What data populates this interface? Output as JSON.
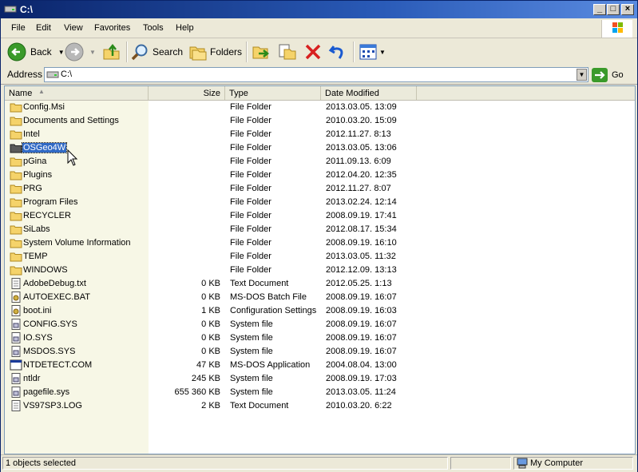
{
  "window": {
    "title": "C:\\"
  },
  "menu": [
    "File",
    "Edit",
    "View",
    "Favorites",
    "Tools",
    "Help"
  ],
  "toolbar": {
    "back_label": "Back",
    "search_label": "Search",
    "folders_label": "Folders"
  },
  "address": {
    "label": "Address",
    "value": "C:\\",
    "go_label": "Go"
  },
  "columns": {
    "name": "Name",
    "size": "Size",
    "type": "Type",
    "date": "Date Modified"
  },
  "files": [
    {
      "name": "Config.Msi",
      "size": "",
      "type": "File Folder",
      "date": "2013.03.05. 13:09",
      "icon": "folder"
    },
    {
      "name": "Documents and Settings",
      "size": "",
      "type": "File Folder",
      "date": "2010.03.20. 15:09",
      "icon": "folder"
    },
    {
      "name": "Intel",
      "size": "",
      "type": "File Folder",
      "date": "2012.11.27. 8:13",
      "icon": "folder"
    },
    {
      "name": "OSGeo4W",
      "size": "",
      "type": "File Folder",
      "date": "2013.03.05. 13:06",
      "icon": "folder",
      "selected": true
    },
    {
      "name": "pGina",
      "size": "",
      "type": "File Folder",
      "date": "2011.09.13. 6:09",
      "icon": "folder"
    },
    {
      "name": "Plugins",
      "size": "",
      "type": "File Folder",
      "date": "2012.04.20. 12:35",
      "icon": "folder"
    },
    {
      "name": "PRG",
      "size": "",
      "type": "File Folder",
      "date": "2012.11.27. 8:07",
      "icon": "folder"
    },
    {
      "name": "Program Files",
      "size": "",
      "type": "File Folder",
      "date": "2013.02.24. 12:14",
      "icon": "folder"
    },
    {
      "name": "RECYCLER",
      "size": "",
      "type": "File Folder",
      "date": "2008.09.19. 17:41",
      "icon": "folder"
    },
    {
      "name": "SiLabs",
      "size": "",
      "type": "File Folder",
      "date": "2012.08.17. 15:34",
      "icon": "folder"
    },
    {
      "name": "System Volume Information",
      "size": "",
      "type": "File Folder",
      "date": "2008.09.19. 16:10",
      "icon": "folder"
    },
    {
      "name": "TEMP",
      "size": "",
      "type": "File Folder",
      "date": "2013.03.05. 11:32",
      "icon": "folder"
    },
    {
      "name": "WINDOWS",
      "size": "",
      "type": "File Folder",
      "date": "2012.12.09. 13:13",
      "icon": "folder"
    },
    {
      "name": "AdobeDebug.txt",
      "size": "0 KB",
      "type": "Text Document",
      "date": "2012.05.25. 1:13",
      "icon": "text"
    },
    {
      "name": "AUTOEXEC.BAT",
      "size": "0 KB",
      "type": "MS-DOS Batch File",
      "date": "2008.09.19. 16:07",
      "icon": "gear"
    },
    {
      "name": "boot.ini",
      "size": "1 KB",
      "type": "Configuration Settings",
      "date": "2008.09.19. 16:03",
      "icon": "gear"
    },
    {
      "name": "CONFIG.SYS",
      "size": "0 KB",
      "type": "System file",
      "date": "2008.09.19. 16:07",
      "icon": "sys"
    },
    {
      "name": "IO.SYS",
      "size": "0 KB",
      "type": "System file",
      "date": "2008.09.19. 16:07",
      "icon": "sys"
    },
    {
      "name": "MSDOS.SYS",
      "size": "0 KB",
      "type": "System file",
      "date": "2008.09.19. 16:07",
      "icon": "sys"
    },
    {
      "name": "NTDETECT.COM",
      "size": "47 KB",
      "type": "MS-DOS Application",
      "date": "2004.08.04. 13:00",
      "icon": "app"
    },
    {
      "name": "ntldr",
      "size": "245 KB",
      "type": "System file",
      "date": "2008.09.19. 17:03",
      "icon": "sys"
    },
    {
      "name": "pagefile.sys",
      "size": "655 360 KB",
      "type": "System file",
      "date": "2013.03.05. 11:24",
      "icon": "sys"
    },
    {
      "name": "VS97SP3.LOG",
      "size": "2 KB",
      "type": "Text Document",
      "date": "2010.03.20. 6:22",
      "icon": "text"
    }
  ],
  "status": {
    "selection": "1 objects selected",
    "zone": "My Computer"
  }
}
